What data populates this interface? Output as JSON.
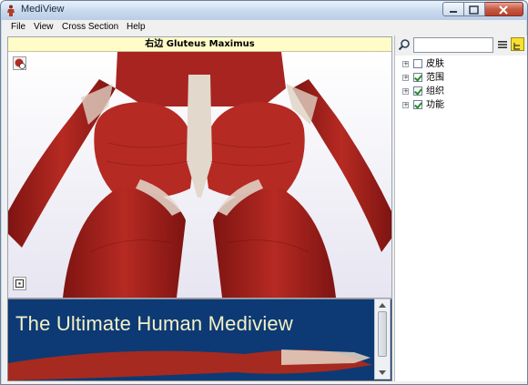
{
  "window": {
    "title": "MediView"
  },
  "menu": {
    "items": [
      "File",
      "View",
      "Cross Section",
      "Help"
    ]
  },
  "viewer": {
    "title": "右边 Gluteus Maximus"
  },
  "banner": {
    "text": "The Ultimate Human Mediview"
  },
  "search": {
    "value": "",
    "placeholder": ""
  },
  "tree": {
    "items": [
      {
        "label": "皮肤",
        "checked": false
      },
      {
        "label": "范围",
        "checked": true
      },
      {
        "label": "组织",
        "checked": true
      },
      {
        "label": "功能",
        "checked": true
      }
    ]
  },
  "colors": {
    "muscle": "#a6201c",
    "tendon": "#e3d8cc",
    "banner_bg": "#0d3a74",
    "banner_text": "#f4f0c8"
  }
}
